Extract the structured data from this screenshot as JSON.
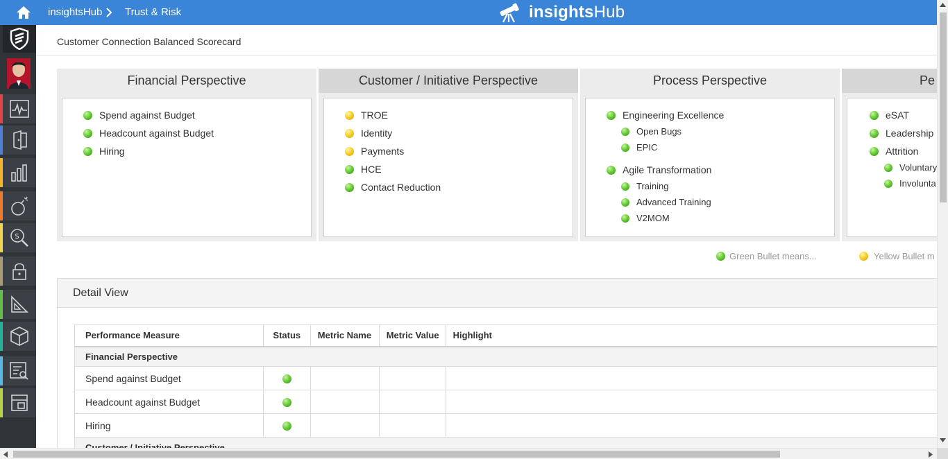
{
  "topbar": {
    "app_crumb": "insightsHub",
    "separator": "›",
    "page_crumb": "Trust & Risk",
    "brand_bold": "insights",
    "brand_light": "Hub"
  },
  "page": {
    "title": "Customer Connection Balanced Scorecard"
  },
  "colors": {
    "topbar": "#3b85d8",
    "rail": "#2f3439",
    "green_status": "#5cc230",
    "yellow_status": "#f5c518"
  },
  "rail": {
    "nav": [
      {
        "icon": "activity-monitor-icon",
        "stripe": "#e2444a"
      },
      {
        "icon": "office-door-icon",
        "stripe": "#4d7fd6"
      },
      {
        "icon": "bar-chart-icon",
        "stripe": "#f5b52a"
      },
      {
        "icon": "bomb-icon",
        "stripe": "#ee7a2b"
      },
      {
        "icon": "money-search-icon",
        "stripe": "#f1d44f"
      },
      {
        "icon": "lock-icon",
        "stripe": "#a99b78"
      },
      {
        "icon": "triangle-ruler-icon",
        "stripe": "#63bd4a"
      },
      {
        "icon": "cube-icon",
        "stripe": "#24b39a"
      },
      {
        "icon": "list-search-icon",
        "stripe": "#5ab6e3"
      },
      {
        "icon": "layout-icon",
        "stripe": "#b8d24a"
      }
    ]
  },
  "perspectives": [
    {
      "title": "Financial Perspective",
      "items": [
        {
          "label": "Spend against Budget",
          "status": "green"
        },
        {
          "label": "Headcount against Budget",
          "status": "green"
        },
        {
          "label": "Hiring",
          "status": "green"
        }
      ]
    },
    {
      "title": "Customer / Initiative Perspective",
      "items": [
        {
          "label": "TROE",
          "status": "yellow"
        },
        {
          "label": "Identity",
          "status": "yellow"
        },
        {
          "label": "Payments",
          "status": "yellow"
        },
        {
          "label": "HCE",
          "status": "green"
        },
        {
          "label": "Contact Reduction",
          "status": "green"
        }
      ]
    },
    {
      "title": "Process Perspective",
      "items": [
        {
          "label": "Engineering Excellence",
          "status": "green"
        },
        {
          "label": "Open Bugs",
          "status": "green"
        },
        {
          "label": "EPIC",
          "status": "green"
        },
        {
          "label": "Agile Transformation",
          "status": "green"
        },
        {
          "label": "Training",
          "status": "green"
        },
        {
          "label": "Advanced Training",
          "status": "green"
        },
        {
          "label": "V2MOM",
          "status": "green"
        }
      ]
    },
    {
      "title": "Pe",
      "items": [
        {
          "label": "eSAT",
          "status": "green"
        },
        {
          "label": "Leadership",
          "status": "green"
        },
        {
          "label": "Attrition",
          "status": "green"
        },
        {
          "label": "Voluntary",
          "status": "green"
        },
        {
          "label": "Involunta",
          "status": "green"
        }
      ]
    }
  ],
  "legend": [
    {
      "label": "Green Bullet means...",
      "status": "green"
    },
    {
      "label": "Yellow Bullet m",
      "status": "yellow"
    }
  ],
  "detail": {
    "title": "Detail View",
    "columns": [
      "Performance Measure",
      "Status",
      "Metric Name",
      "Metric Value",
      "Highlight"
    ],
    "groups": [
      {
        "name": "Financial Perspective",
        "rows": [
          {
            "measure": "Spend against Budget",
            "status": "green",
            "metric_name": "",
            "metric_value": "",
            "highlight": ""
          },
          {
            "measure": "Headcount against Budget",
            "status": "green",
            "metric_name": "",
            "metric_value": "",
            "highlight": ""
          },
          {
            "measure": "Hiring",
            "status": "green",
            "metric_name": "",
            "metric_value": "",
            "highlight": ""
          }
        ]
      },
      {
        "name": "Customer / Initiative Perspective",
        "rows": []
      }
    ]
  }
}
